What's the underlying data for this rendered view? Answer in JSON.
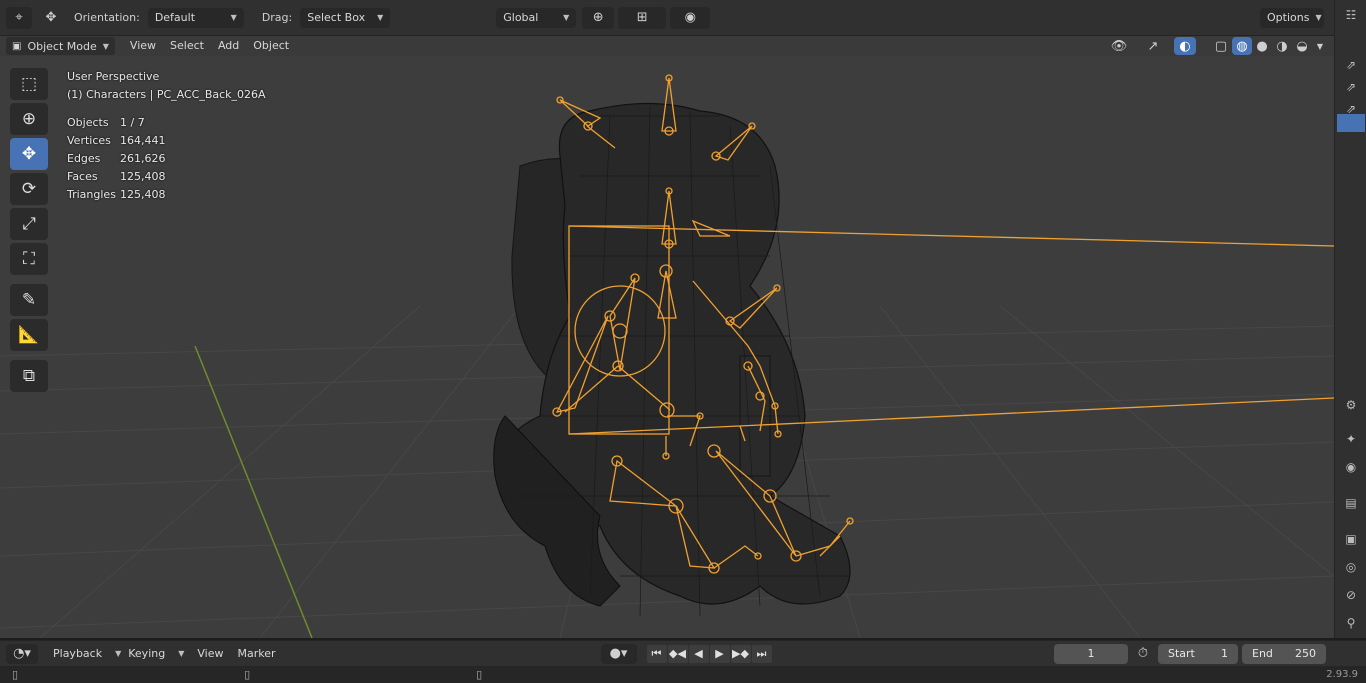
{
  "topbar": {
    "orientation_label": "Orientation:",
    "orientation_value": "Default",
    "drag_label": "Drag:",
    "drag_value": "Select Box",
    "transform_space": "Global",
    "options_label": "Options"
  },
  "header": {
    "mode": "Object Mode",
    "menus": [
      "View",
      "Select",
      "Add",
      "Object"
    ]
  },
  "overlay": {
    "view_name": "User Perspective",
    "object_name": "(1) Characters | PC_ACC_Back_026A",
    "stats": [
      {
        "label": "Objects",
        "value": "1 / 7"
      },
      {
        "label": "Vertices",
        "value": "164,441"
      },
      {
        "label": "Edges",
        "value": "261,626"
      },
      {
        "label": "Faces",
        "value": "125,408"
      },
      {
        "label": "Triangles",
        "value": "125,408"
      }
    ]
  },
  "tools": [
    {
      "name": "select-box-tool",
      "icon": "select-box-icon",
      "active": false
    },
    {
      "name": "cursor-tool",
      "icon": "cursor-icon",
      "active": false
    },
    {
      "name": "move-tool",
      "icon": "move-icon",
      "active": true
    },
    {
      "name": "rotate-tool",
      "icon": "rotate-icon",
      "active": false
    },
    {
      "name": "scale-tool",
      "icon": "scale-icon",
      "active": false
    },
    {
      "name": "transform-tool",
      "icon": "transform-icon",
      "active": false
    },
    {
      "name": "annotate-tool",
      "icon": "annotate-icon",
      "active": false
    },
    {
      "name": "measure-tool",
      "icon": "measure-icon",
      "active": false
    },
    {
      "name": "add-cube-tool",
      "icon": "add-cube-icon",
      "active": false
    }
  ],
  "timeline": {
    "menus": [
      "Playback",
      "Keying",
      "View",
      "Marker"
    ],
    "current_frame": "1",
    "start_label": "Start",
    "start_value": "1",
    "end_label": "End",
    "end_value": "250"
  },
  "version": "2.93.9",
  "colors": {
    "accent": "#4772b3",
    "armature": "#f0a030",
    "viewport_bg": "#3d3d3d"
  }
}
